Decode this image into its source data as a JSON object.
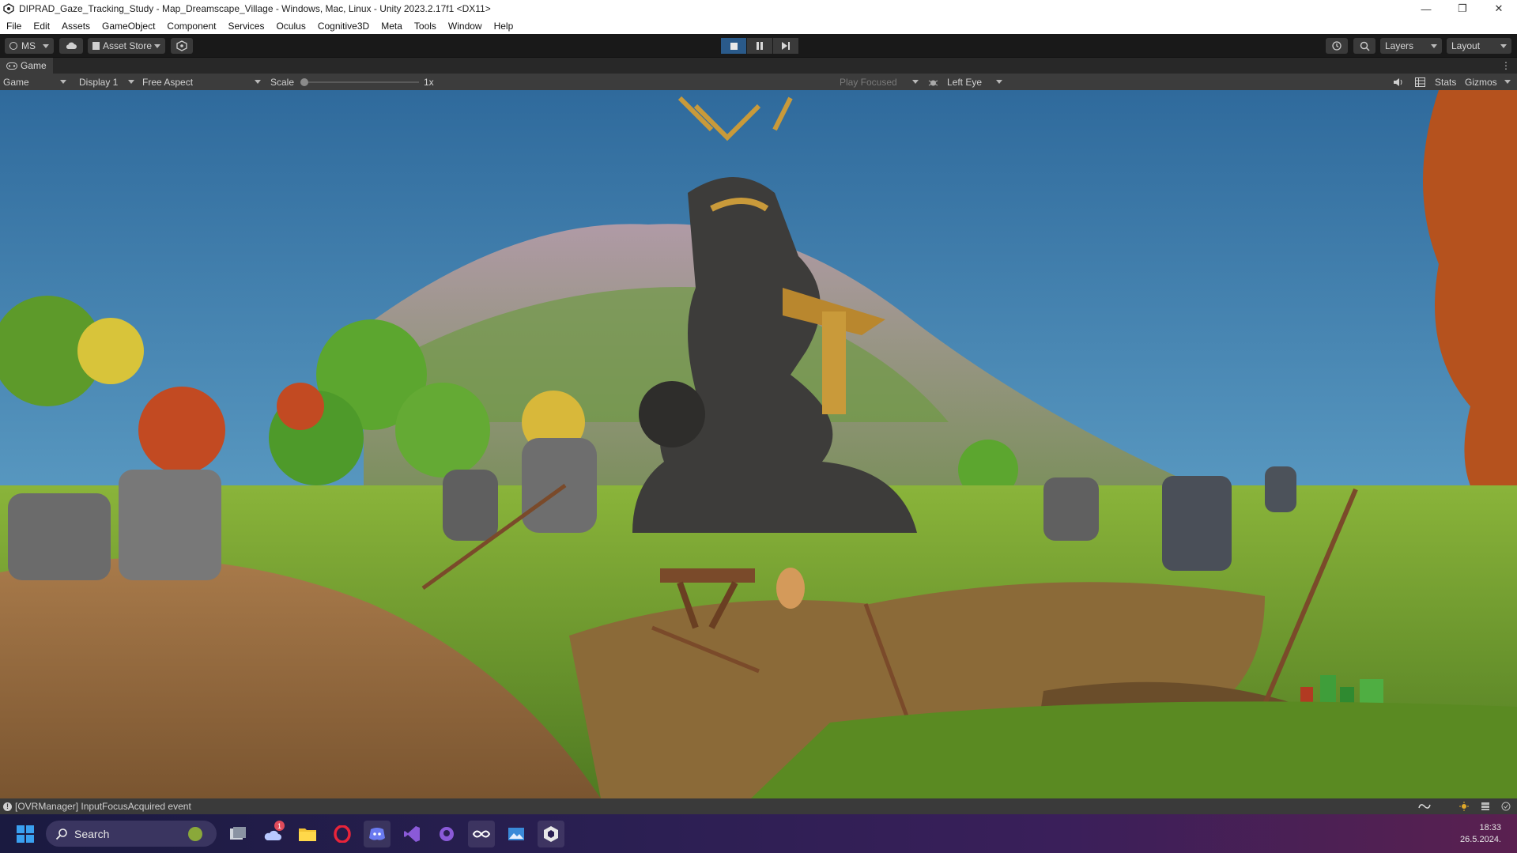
{
  "window": {
    "title": "DIPRAD_Gaze_Tracking_Study - Map_Dreamscape_Village - Windows, Mac, Linux - Unity 2023.2.17f1 <DX11>"
  },
  "menu": {
    "items": [
      "File",
      "Edit",
      "Assets",
      "GameObject",
      "Component",
      "Services",
      "Oculus",
      "Cognitive3D",
      "Meta",
      "Tools",
      "Window",
      "Help"
    ]
  },
  "toolbar": {
    "account_label": "MS",
    "asset_store_label": "Asset Store",
    "layers_label": "Layers",
    "layout_label": "Layout"
  },
  "game_tab": {
    "label": "Game"
  },
  "game_toolbar": {
    "view_select": "Game",
    "display_select": "Display 1",
    "aspect_select": "Free Aspect",
    "scale_label": "Scale",
    "scale_value": "1x",
    "play_mode_select": "Play Focused",
    "eye_select": "Left Eye",
    "stats_label": "Stats",
    "gizmos_label": "Gizmos"
  },
  "status": {
    "message": "[OVRManager] InputFocusAcquired event"
  },
  "taskbar": {
    "search_placeholder": "Search",
    "weather_badge": "1",
    "time": "18:33",
    "date": "26.5.2024."
  },
  "colors": {
    "accent_blue": "#2a5a8a",
    "unity_dark": "#191919",
    "panel": "#3c3c3c",
    "sky": "#3f78a8",
    "grass": "#6b9a2c"
  }
}
